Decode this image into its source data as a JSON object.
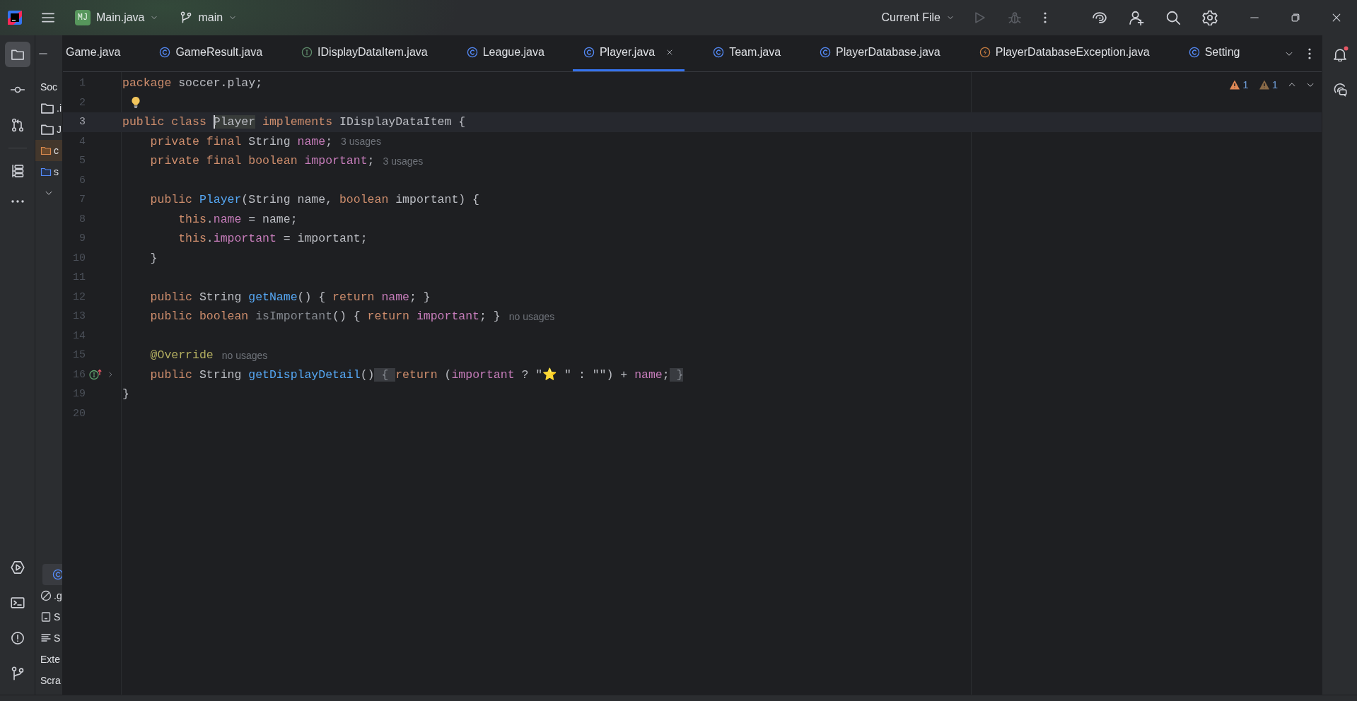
{
  "title_bar": {
    "project": {
      "badge": "MJ",
      "name": "Main.java"
    },
    "branch": "main",
    "run_configuration": "Current File"
  },
  "left_toolbar": {
    "top": [
      {
        "kind": "project",
        "selected": true
      },
      {
        "kind": "commit",
        "selected": false
      },
      {
        "kind": "pull-requests",
        "selected": false
      },
      {
        "kind": "structure",
        "selected": false
      },
      {
        "kind": "more",
        "selected": false
      }
    ],
    "bottom": [
      {
        "kind": "services",
        "selected": false
      },
      {
        "kind": "terminal",
        "selected": false
      },
      {
        "kind": "problems",
        "selected": false
      },
      {
        "kind": "git",
        "selected": false
      }
    ]
  },
  "right_toolbar": [
    {
      "kind": "notifications",
      "unread": true
    },
    {
      "kind": "ai-chat",
      "unread": false
    }
  ],
  "project_panel": {
    "upper_rows": [
      {
        "kind": "root",
        "label": "Soc",
        "selected": false
      },
      {
        "kind": "folder",
        "label": ".i",
        "selected": false
      },
      {
        "kind": "folder",
        "label": "J",
        "selected": false
      },
      {
        "kind": "excluded-folder",
        "label": "c",
        "selected": false
      },
      {
        "kind": "source-folder",
        "label": "s",
        "selected": false
      },
      {
        "kind": "expander",
        "selected": false
      }
    ],
    "lower_rows": [
      {
        "kind": "class",
        "selected": true
      },
      {
        "kind": "ignored",
        "label": ".g",
        "selected": false
      },
      {
        "kind": "console",
        "label": "S",
        "selected": false
      },
      {
        "kind": "text",
        "label": "S",
        "selected": false
      },
      {
        "kind": "root",
        "label": "Exte",
        "selected": false
      },
      {
        "kind": "root",
        "label": "Scra",
        "selected": false
      }
    ]
  },
  "tabs": [
    {
      "label": "Game.java",
      "kind": "plain",
      "selected": false
    },
    {
      "label": "GameResult.java",
      "kind": "class",
      "selected": false
    },
    {
      "label": "IDisplayDataItem.java",
      "kind": "interface",
      "selected": false
    },
    {
      "label": "League.java",
      "kind": "class",
      "selected": false
    },
    {
      "label": "Player.java",
      "kind": "class",
      "selected": true
    },
    {
      "label": "Team.java",
      "kind": "class",
      "selected": false
    },
    {
      "label": "PlayerDatabase.java",
      "kind": "class",
      "selected": false
    },
    {
      "label": "PlayerDatabaseException.java",
      "kind": "exception",
      "selected": false
    },
    {
      "label": "Setting",
      "kind": "class",
      "selected": false
    }
  ],
  "inspections": [
    {
      "kind": "warning",
      "count": "1"
    },
    {
      "kind": "weak-warning",
      "count": "1"
    }
  ],
  "editor": {
    "lines": [
      {
        "number": "1",
        "current": false,
        "tokens": [
          {
            "kind": "kw",
            "text": "package"
          },
          {
            "kind": "plain",
            "text": " soccer.play;"
          }
        ]
      },
      {
        "number": "2",
        "current": false,
        "kind": "bulb"
      },
      {
        "number": "3",
        "current": true,
        "tokens": [
          {
            "kind": "kw",
            "text": "public class "
          },
          {
            "kind": "decl",
            "text": "Player"
          },
          {
            "kind": "kw",
            "text": " implements "
          },
          {
            "kind": "plain",
            "text": "IDisplayDataItem {"
          }
        ]
      },
      {
        "number": "4",
        "current": false,
        "hint": "3 usages",
        "tokens": [
          {
            "kind": "kw",
            "text": "    private final "
          },
          {
            "kind": "plain",
            "text": "String "
          },
          {
            "kind": "field",
            "text": "name"
          },
          {
            "kind": "plain",
            "text": ";"
          }
        ]
      },
      {
        "number": "5",
        "current": false,
        "hint": "3 usages",
        "tokens": [
          {
            "kind": "kw",
            "text": "    private final boolean "
          },
          {
            "kind": "field",
            "text": "important"
          },
          {
            "kind": "plain",
            "text": ";"
          }
        ]
      },
      {
        "number": "6",
        "current": false
      },
      {
        "number": "7",
        "current": false,
        "tokens": [
          {
            "kind": "kw",
            "text": "    public "
          },
          {
            "kind": "method",
            "text": "Player"
          },
          {
            "kind": "plain",
            "text": "(String name, "
          },
          {
            "kind": "kw",
            "text": "boolean "
          },
          {
            "kind": "plain",
            "text": "important) {"
          }
        ]
      },
      {
        "number": "8",
        "current": false,
        "tokens": [
          {
            "kind": "kw",
            "text": "        this"
          },
          {
            "kind": "plain",
            "text": "."
          },
          {
            "kind": "field",
            "text": "name"
          },
          {
            "kind": "plain",
            "text": " = name;"
          }
        ]
      },
      {
        "number": "9",
        "current": false,
        "tokens": [
          {
            "kind": "kw",
            "text": "        this"
          },
          {
            "kind": "plain",
            "text": "."
          },
          {
            "kind": "field",
            "text": "important"
          },
          {
            "kind": "plain",
            "text": " = important;"
          }
        ]
      },
      {
        "number": "10",
        "current": false,
        "tokens": [
          {
            "kind": "plain",
            "text": "    }"
          }
        ]
      },
      {
        "number": "11",
        "current": false
      },
      {
        "number": "12",
        "current": false,
        "tokens": [
          {
            "kind": "kw",
            "text": "    public "
          },
          {
            "kind": "plain",
            "text": "String "
          },
          {
            "kind": "method",
            "text": "getName"
          },
          {
            "kind": "plain",
            "text": "() { "
          },
          {
            "kind": "kw",
            "text": "return "
          },
          {
            "kind": "field",
            "text": "name"
          },
          {
            "kind": "plain",
            "text": "; }"
          }
        ]
      },
      {
        "number": "13",
        "current": false,
        "hint": "no usages",
        "tokens": [
          {
            "kind": "kw",
            "text": "    public boolean "
          },
          {
            "kind": "unused",
            "text": "isImportant"
          },
          {
            "kind": "plain",
            "text": "() { "
          },
          {
            "kind": "kw",
            "text": "return "
          },
          {
            "kind": "field",
            "text": "important"
          },
          {
            "kind": "plain",
            "text": "; }"
          }
        ]
      },
      {
        "number": "14",
        "current": false
      },
      {
        "number": "15",
        "current": false,
        "hint": "no usages",
        "tokens": [
          {
            "kind": "annotation",
            "text": "    @Override"
          }
        ]
      },
      {
        "number": "16",
        "current": false,
        "kind": "override",
        "tokens": [
          {
            "kind": "kw",
            "text": "    public "
          },
          {
            "kind": "plain",
            "text": "String "
          },
          {
            "kind": "method",
            "text": "getDisplayDetail"
          },
          {
            "kind": "plain",
            "text": "()"
          },
          {
            "kind": "fold",
            "text": " { "
          },
          {
            "kind": "kw",
            "text": "return "
          },
          {
            "kind": "plain",
            "text": "("
          },
          {
            "kind": "field",
            "text": "important"
          },
          {
            "kind": "plain",
            "text": " ? "
          },
          {
            "kind": "string",
            "text": "\""
          },
          {
            "kind": "emoji",
            "text": "⭐"
          },
          {
            "kind": "string",
            "text": " \""
          },
          {
            "kind": "plain",
            "text": " : "
          },
          {
            "kind": "string",
            "text": "\"\""
          },
          {
            "kind": "plain",
            "text": ") + "
          },
          {
            "kind": "field",
            "text": "name"
          },
          {
            "kind": "plain",
            "text": ";"
          },
          {
            "kind": "fold",
            "text": " }"
          }
        ]
      },
      {
        "number": "19",
        "current": false,
        "tokens": [
          {
            "kind": "plain",
            "text": "}"
          }
        ]
      },
      {
        "number": "20",
        "current": false
      }
    ]
  }
}
